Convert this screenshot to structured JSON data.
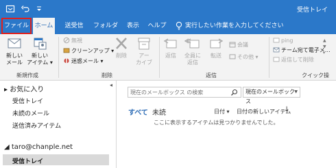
{
  "titlebar": {
    "title": "受信トレイ",
    "quick_access": [
      {
        "icon": "send-receive-icon",
        "glyph": "⟳"
      },
      {
        "icon": "undo-icon",
        "glyph": "↶"
      },
      {
        "icon": "customize-dropdown-icon",
        "glyph": "▾"
      }
    ]
  },
  "tabs": [
    {
      "label": "ファイル",
      "name": "tab-file"
    },
    {
      "label": "ホーム",
      "name": "tab-home"
    },
    {
      "label": "送受信",
      "name": "tab-send-receive"
    },
    {
      "label": "フォルダー",
      "name": "tab-folder"
    },
    {
      "label": "表示",
      "name": "tab-view"
    },
    {
      "label": "ヘルプ",
      "name": "tab-help"
    }
  ],
  "tellme": {
    "label": "実行したい作業を入力してください",
    "icon": "lightbulb-icon"
  },
  "ribbon": {
    "new_group": {
      "label": "新規作成",
      "new_mail": {
        "line1": "新しい",
        "line2": "メール"
      },
      "new_items": {
        "line1": "新しい",
        "line2": "アイテム ▾"
      }
    },
    "delete_group": {
      "label": "削除",
      "ignore": "無視",
      "cleanup": "クリーンアップ ▾",
      "junk": "迷惑メール ▾",
      "delete": "削除",
      "archive": {
        "line1": "アー",
        "line2": "カイブ"
      }
    },
    "respond_group": {
      "label": "返信",
      "reply": "返信",
      "reply_all": {
        "line1": "全員に",
        "line2": "返信"
      },
      "forward": "転送",
      "meeting": "会議",
      "more": "その他 ▾"
    },
    "quicksteps_group": {
      "label": "クイック操",
      "items": [
        "ping",
        "チーム宛て電子メ…",
        "返信して削除"
      ]
    }
  },
  "folders": {
    "favorites_label": "お気に入り",
    "favorites": [
      "受信トレイ",
      "未読のメール",
      "送信済みアイテム"
    ],
    "account": "taro@chanple.net",
    "selected": "受信トレイ"
  },
  "messages": {
    "search_placeholder": "現在のメールボックス の検索",
    "scope": "現在のメールボックス",
    "filter_all": "すべて",
    "filter_unread": "未読",
    "sort_by": "日付 ▾",
    "sort_order": "日付の新しいアイテム",
    "sort_arrow": "↓",
    "empty_text": "ここに表示するアイテムは見つかりませんでした。"
  },
  "colors": {
    "accent": "#2b78c9",
    "highlight_box": "#e0201c",
    "selected_folder": "#d9d9d9"
  }
}
